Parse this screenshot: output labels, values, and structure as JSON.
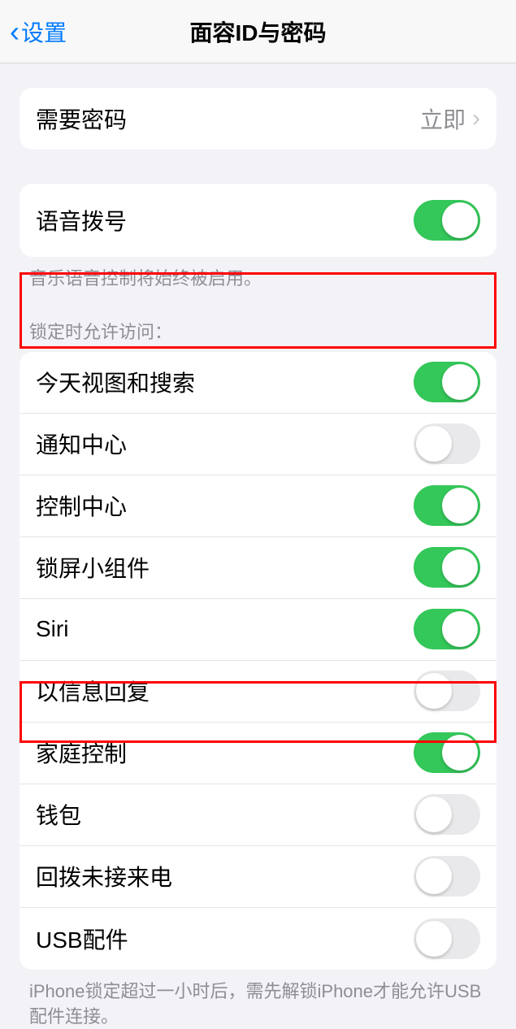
{
  "header": {
    "back_label": "设置",
    "title": "面容ID与密码"
  },
  "require_passcode": {
    "label": "需要密码",
    "value": "立即"
  },
  "voice_dial": {
    "label": "语音拨号",
    "footer": "音乐语音控制将始终被启用。"
  },
  "locked_section": {
    "header": "锁定时允许访问：",
    "items": [
      {
        "label": "今天视图和搜索",
        "on": true
      },
      {
        "label": "通知中心",
        "on": false
      },
      {
        "label": "控制中心",
        "on": true
      },
      {
        "label": "锁屏小组件",
        "on": true
      },
      {
        "label": "Siri",
        "on": true
      },
      {
        "label": "以信息回复",
        "on": false
      },
      {
        "label": "家庭控制",
        "on": true
      },
      {
        "label": "钱包",
        "on": false
      },
      {
        "label": "回拨未接来电",
        "on": false
      },
      {
        "label": "USB配件",
        "on": false
      }
    ],
    "footer": "iPhone锁定超过一小时后，需先解锁iPhone才能允许USB配件连接。"
  }
}
